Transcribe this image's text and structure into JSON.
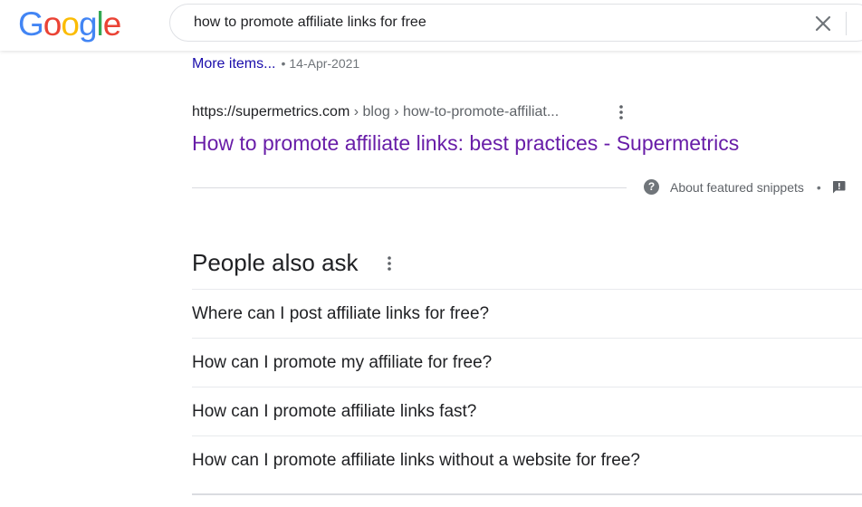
{
  "header": {
    "logo_letters": [
      "G",
      "o",
      "o",
      "g",
      "l",
      "e"
    ],
    "logo_colors": [
      "#4285f4",
      "#ea4335",
      "#fbbc05",
      "#4285f4",
      "#34a853",
      "#ea4335"
    ],
    "search_query": "how to promote affiliate links for free",
    "clear_icon": "close-icon"
  },
  "previous_result": {
    "more_items_label": "More items...",
    "separator": "•",
    "date": "14-Apr-2021"
  },
  "featured_result": {
    "cite_domain": "https://supermetrics.com",
    "cite_path": " › blog › how-to-promote-affiliat...",
    "menu_icon": "more-vert-icon",
    "title": "How to promote affiliate links: best practices - Supermetrics",
    "title_color": "#681da8"
  },
  "snippet_footer": {
    "help_icon": "question-icon",
    "about_label": "About featured snippets",
    "separator": "•",
    "feedback_icon": "feedback-icon"
  },
  "people_also_ask": {
    "title": "People also ask",
    "menu_icon": "more-vert-icon",
    "questions": [
      "Where can I post affiliate links for free?",
      "How can I promote my affiliate for free?",
      "How can I promote affiliate links fast?",
      "How can I promote affiliate links without a website for free?"
    ]
  },
  "colors": {
    "link_blue": "#1a0dab",
    "visited_purple": "#681da8",
    "secondary_text": "#70757a"
  }
}
